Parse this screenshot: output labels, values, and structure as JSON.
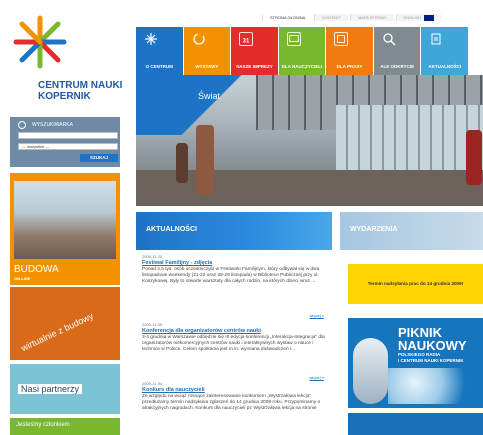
{
  "brand": {
    "name_line1": "CENTRUM NAUKI",
    "name_line2": "KOPERNIK",
    "colors": {
      "blue": "#1d73c6",
      "orange": "#f39200",
      "green": "#79b72f",
      "red": "#e22d2a",
      "yellow": "#ffd400"
    }
  },
  "utility_nav": [
    {
      "label": "STRONA GŁÓWNA",
      "active": true
    },
    {
      "label": "KONTAKT",
      "active": false
    },
    {
      "label": "MAPA STRONY",
      "active": false
    },
    {
      "label": "ENGLISH",
      "active": false
    }
  ],
  "main_nav": [
    {
      "label": "O CENTRUM",
      "color": "#1d73c6",
      "icon": "star-burst-icon"
    },
    {
      "label": "WYSTAWY",
      "color": "#f39200",
      "icon": "refresh-icon"
    },
    {
      "label": "NASZE IMPREZY",
      "color": "#e22d2a",
      "icon": "calendar-icon"
    },
    {
      "label": "DLA NAUCZYCIELI",
      "color": "#79b72f",
      "icon": "board-icon"
    },
    {
      "label": "DLA PRASY",
      "color": "#f07b10",
      "icon": "press-icon"
    },
    {
      "label": "ALE ODKRYCIE",
      "color": "#7f8a91",
      "icon": "magnifier-icon"
    },
    {
      "label": "AKTUALNOŚCI",
      "color": "#3fa6d8",
      "icon": "document-icon"
    }
  ],
  "hero": {
    "label": "Świat"
  },
  "search": {
    "title": "WYSZUKIWARKA",
    "input_value": "",
    "select_value": "--- wszystkie ---",
    "button_label": "SZUKAJ"
  },
  "tiles": {
    "budowa_title": "BUDOWA",
    "budowa_sub": "ON-LINE",
    "wirtual_title": "wirtualnie z budowy",
    "partners": "Nasi partnerzy",
    "members": "Jesteśmy członkiem"
  },
  "news": {
    "title": "AKTUALNOŚCI",
    "items": [
      {
        "date": "2009-11-20",
        "title": "Festiwal Familijny - zdjęcia",
        "body": "Ponad 2,5 tys. osób uczestniczyło w Festiwalu Familijnym, który odbywał się w dwa listopadowe weekendy (21-22 oraz 28-29 listopada) w Bibliotece Publicznej przy ul. Koszykowej. Były to otwarte warsztaty dla całych rodzin, na których dzieci wraz ...",
        "more": "więcej »"
      },
      {
        "date": "2009-11-05",
        "title": "Konferencja dla organizatorów centrów nauki",
        "body": "3-4 grudnia w Warszawie odbędzie się III edycja konferencji „Interakcja-Integracja\" dla organizatorów niekomercyjnych centrów nauki i interaktywnych wystaw o nauce i technice w Polsce. Celem spotkania jest m.in. wymiana doświadczeń i...",
        "more": "więcej »"
      },
      {
        "date": "2009-11-04",
        "title": "Konkurs dla nauczycieli",
        "body": "Ze względu na wciąż rosnące zainteresowanie konkursem „Wystrzałowa lekcja\" przedłużamy termin nadsyłania zgłoszeń do 14 grudnia 2009 roku. Przypominamy o atrakcyjnych nagrodach. Konkurs dla nauczycieli pt: Wystrzałowa lekcja na stronie",
        "more": ""
      }
    ]
  },
  "events": {
    "title": "WYDARZENIA",
    "notice": "Termin nadsyłania prac do 14 grudnia 2009!",
    "piknik_title1": "PIKNIK",
    "piknik_title2": "NAUKOWY",
    "piknik_sub1": "POLSKIEGO RADIA",
    "piknik_sub2": "I CENTRUM NAUKI KOPERNIK"
  }
}
